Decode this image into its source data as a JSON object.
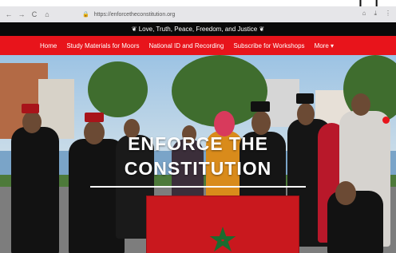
{
  "corner_text": "[ ]",
  "browser": {
    "back_icon": "←",
    "forward_icon": "→",
    "reload_icon": "C",
    "home_icon": "⌂",
    "url": "https://enforcetheconstitution.org",
    "right_icons": [
      "⌂",
      "⤓",
      "⋮"
    ]
  },
  "site": {
    "banner_text": "Love, Truth, Peace, Freedom, and Justice",
    "nav": [
      "Home",
      "Study Materials for Moors",
      "National ID and Recording",
      "Subscribe for Workshops",
      "More"
    ],
    "hero_title_line1": "ENFORCE THE",
    "hero_title_line2": "CONSTITUTION"
  },
  "colors": {
    "nav_red": "#e8141b",
    "banner_black": "#0a0a0a",
    "flag_red": "#c9181e",
    "star_green": "#1b6b2f"
  }
}
